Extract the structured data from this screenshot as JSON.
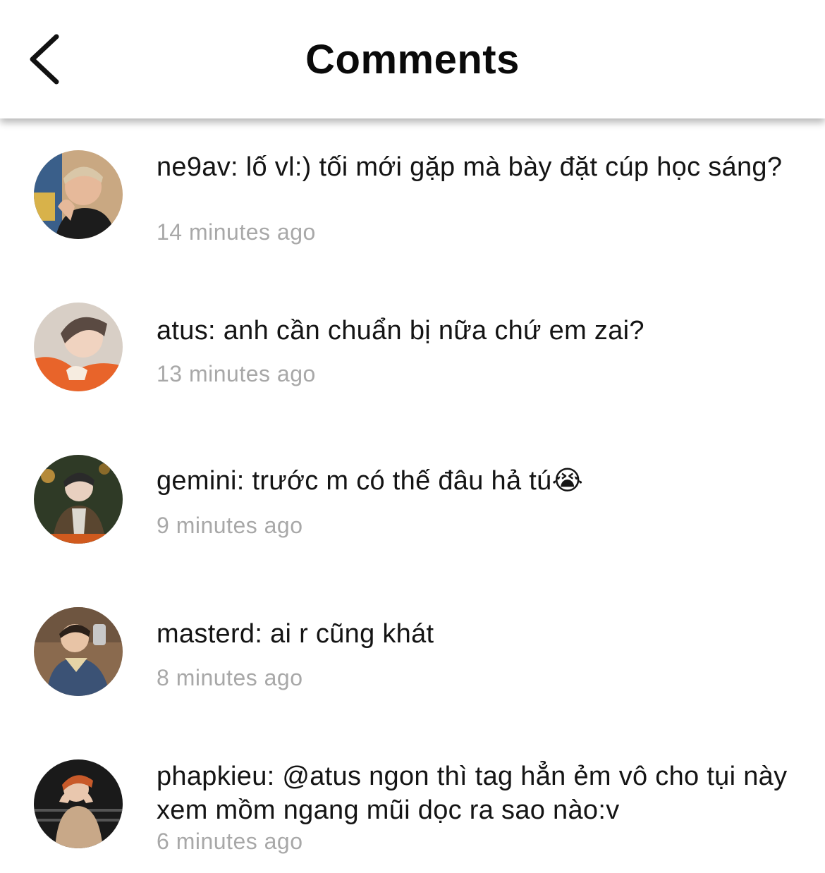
{
  "header": {
    "title": "Comments",
    "back_icon": "chevron-left-icon"
  },
  "comments": [
    {
      "text": "ne9av: lố vl:) tối mới gặp mà bày đặt cúp học sáng?",
      "time": "14 minutes ago"
    },
    {
      "text": "atus: anh cần chuẩn bị nữa chứ em zai?",
      "time": "13 minutes ago"
    },
    {
      "text": "gemini: trước m có thế đâu hả tú😭",
      "time": "9 minutes ago"
    },
    {
      "text": "masterd: ai r cũng khát",
      "time": "8 minutes ago"
    },
    {
      "text": "phapkieu: @atus ngon thì tag hẳn ẻm vô cho tụi này xem mồm ngang mũi dọc ra sao nào:v",
      "time": "6 minutes ago"
    }
  ],
  "colors": {
    "timestamp": "#a8a8a8",
    "text": "#141414"
  }
}
